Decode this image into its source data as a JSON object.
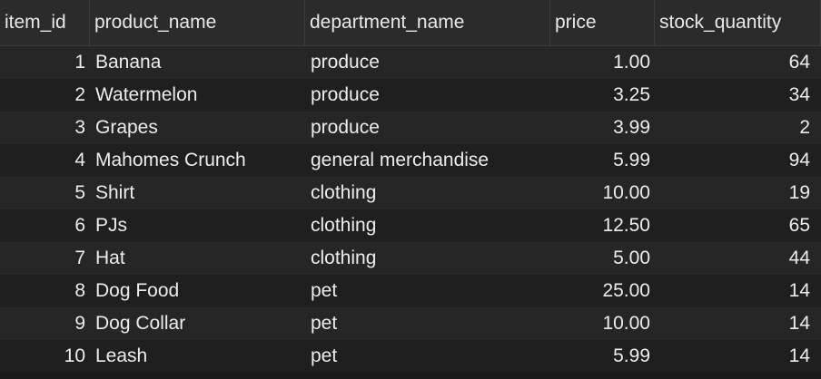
{
  "table": {
    "columns": [
      "item_id",
      "product_name",
      "department_name",
      "price",
      "stock_quantity"
    ],
    "rows": [
      [
        "1",
        "Banana",
        "produce",
        "1.00",
        "64"
      ],
      [
        "2",
        "Watermelon",
        "produce",
        "3.25",
        "34"
      ],
      [
        "3",
        "Grapes",
        "produce",
        "3.99",
        "2"
      ],
      [
        "4",
        "Mahomes Crunch",
        "general merchandise",
        "5.99",
        "94"
      ],
      [
        "5",
        "Shirt",
        "clothing",
        "10.00",
        "19"
      ],
      [
        "6",
        "PJs",
        "clothing",
        "12.50",
        "65"
      ],
      [
        "7",
        "Hat",
        "clothing",
        "5.00",
        "44"
      ],
      [
        "8",
        "Dog Food",
        "pet",
        "25.00",
        "14"
      ],
      [
        "9",
        "Dog Collar",
        "pet",
        "10.00",
        "14"
      ],
      [
        "10",
        "Leash",
        "pet",
        "5.99",
        "14"
      ]
    ]
  },
  "colors": {
    "background": "#1e1e1e",
    "header_background": "#2b2b2b",
    "row_alt": "#262626",
    "text": "#ececec"
  }
}
